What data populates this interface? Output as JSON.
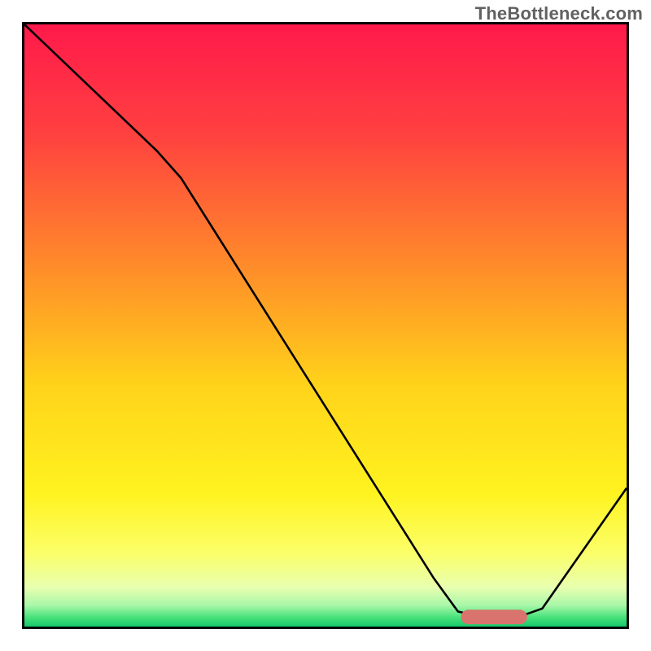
{
  "watermark": "TheBottleneck.com",
  "chart_data": {
    "type": "line",
    "title": "",
    "xlabel": "",
    "ylabel": "",
    "xlim": [
      0,
      100
    ],
    "ylim": [
      0,
      100
    ],
    "grid": false,
    "legend": false,
    "gradient_stops": [
      {
        "offset": 0,
        "color": "#ff1a4b"
      },
      {
        "offset": 0.18,
        "color": "#ff4040"
      },
      {
        "offset": 0.4,
        "color": "#ff8b2a"
      },
      {
        "offset": 0.6,
        "color": "#ffd31a"
      },
      {
        "offset": 0.78,
        "color": "#fff320"
      },
      {
        "offset": 0.88,
        "color": "#fbff6b"
      },
      {
        "offset": 0.935,
        "color": "#e8ffb0"
      },
      {
        "offset": 0.965,
        "color": "#a8f7a8"
      },
      {
        "offset": 0.985,
        "color": "#46e07a"
      },
      {
        "offset": 1.0,
        "color": "#17c96b"
      }
    ],
    "series": [
      {
        "name": "bottleneck-curve",
        "stroke": "#000000",
        "points": [
          {
            "x": 0,
            "y": 100
          },
          {
            "x": 22,
            "y": 79
          },
          {
            "x": 26,
            "y": 74.5
          },
          {
            "x": 68,
            "y": 8
          },
          {
            "x": 72,
            "y": 2.5
          },
          {
            "x": 76,
            "y": 1.6
          },
          {
            "x": 82,
            "y": 1.6
          },
          {
            "x": 86,
            "y": 3
          },
          {
            "x": 100,
            "y": 23
          }
        ]
      }
    ],
    "markers": [
      {
        "name": "optimal-marker",
        "shape": "rounded-rect",
        "color": "#d9736d",
        "x_center": 78,
        "y_center": 1.6,
        "width": 11,
        "height": 2.4,
        "rx": 1.2
      }
    ]
  }
}
